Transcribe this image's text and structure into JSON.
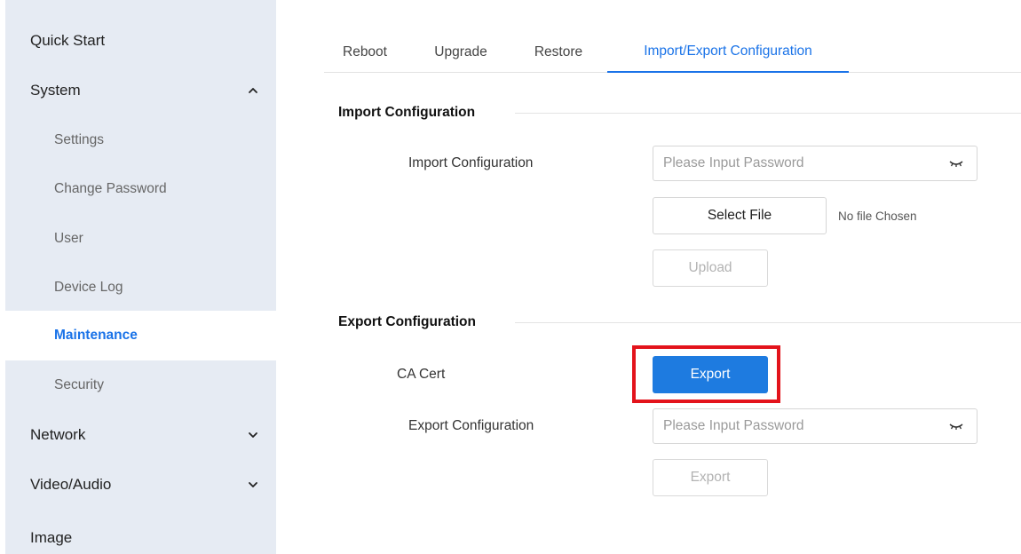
{
  "sidebar": {
    "items": [
      {
        "label": "Quick Start"
      },
      {
        "label": "System",
        "icon": "chevron-up-icon"
      },
      {
        "label": "Settings"
      },
      {
        "label": "Change Password"
      },
      {
        "label": "User"
      },
      {
        "label": "Device Log"
      },
      {
        "label": "Maintenance",
        "active": true
      },
      {
        "label": "Security"
      },
      {
        "label": "Network",
        "icon": "chevron-down-icon"
      },
      {
        "label": "Video/Audio",
        "icon": "chevron-down-icon"
      },
      {
        "label": "Image"
      }
    ]
  },
  "tabs": [
    {
      "label": "Reboot"
    },
    {
      "label": "Upgrade"
    },
    {
      "label": "Restore"
    },
    {
      "label": "Import/Export Configuration",
      "active": true
    }
  ],
  "import_section": {
    "title": "Import Configuration",
    "field_label": "Import Configuration",
    "password_placeholder": "Please Input Password",
    "password_value": "",
    "select_file_label": "Select File",
    "file_status": "No file Chosen",
    "upload_label": "Upload",
    "upload_disabled": true
  },
  "export_section": {
    "title": "Export Configuration",
    "ca_cert_label": "CA Cert",
    "ca_export_label": "Export",
    "field_label": "Export Configuration",
    "password_placeholder": "Please Input Password",
    "password_value": "",
    "export_label": "Export",
    "export_disabled": true
  },
  "colors": {
    "accent": "#1a73e8",
    "primary_button": "#1e7be0",
    "sidebar_bg": "#e6ebf3",
    "highlight": "#e3131b"
  }
}
